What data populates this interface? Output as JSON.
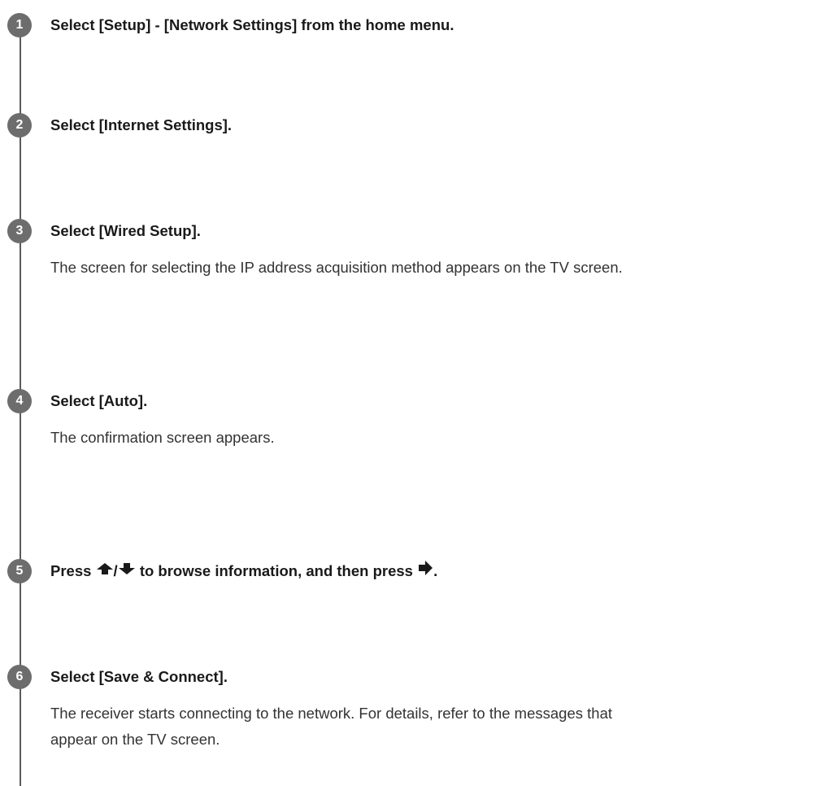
{
  "steps": [
    {
      "number": "1",
      "title": "Select [Setup] - [Network Settings] from the home menu."
    },
    {
      "number": "2",
      "title": "Select [Internet Settings]."
    },
    {
      "number": "3",
      "title": "Select [Wired Setup].",
      "description": "The screen for selecting the IP address acquisition method appears on the TV screen."
    },
    {
      "number": "4",
      "title": "Select [Auto].",
      "description": "The confirmation screen appears."
    },
    {
      "number": "5",
      "title_parts": [
        "Press",
        "/",
        "to browse information, and then press",
        "."
      ],
      "icons": [
        "up-arrow-icon",
        "down-arrow-icon",
        "right-arrow-icon"
      ]
    },
    {
      "number": "6",
      "title": "Select [Save & Connect].",
      "description": "The receiver starts connecting to the network. For details, refer to the messages that appear on the TV screen."
    }
  ]
}
